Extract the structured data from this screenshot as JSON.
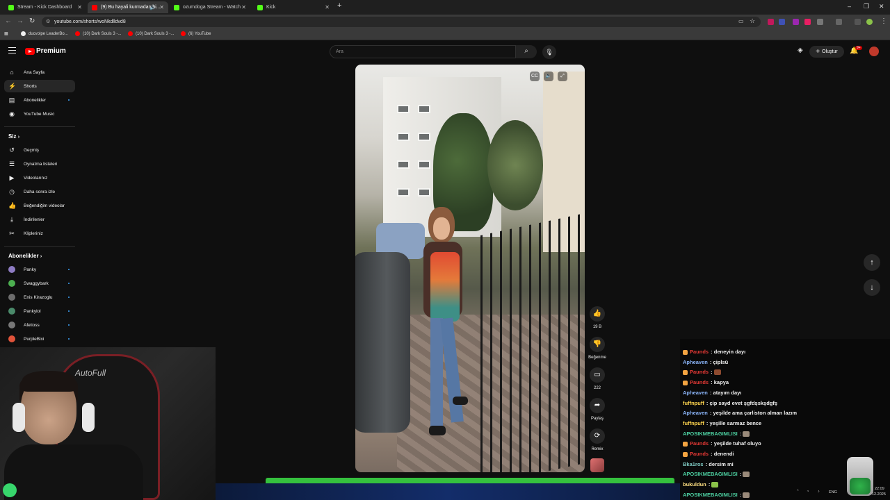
{
  "browser": {
    "tabs": [
      {
        "title": "Stream - Kick Dashboard",
        "favicon_color": "#53fc18"
      },
      {
        "title": "(9) Bu hayali kurmadan bi...",
        "favicon_color": "#ff0000"
      },
      {
        "title": "ozumdoga Stream - Watch",
        "favicon_color": "#53fc18"
      },
      {
        "title": "Kick",
        "favicon_color": "#53fc18"
      }
    ],
    "url": "youtube.com/shorts/woNkdlldvd8",
    "bookmarks": [
      "ducvolpe LeaderBo...",
      "(10) Dark Souls 3 -...",
      "(10) Dark Souls 3 -...",
      "(6) YouTube"
    ]
  },
  "youtube": {
    "brand": "Premium",
    "search_placeholder": "Ara",
    "create_label": "Oluştur",
    "notif_badge": "9+",
    "sidebar": {
      "main": [
        {
          "label": "Ana Sayfa",
          "icon": "home-icon"
        },
        {
          "label": "Shorts",
          "icon": "shorts-icon"
        },
        {
          "label": "Abonelikler",
          "icon": "subscriptions-icon"
        },
        {
          "label": "YouTube Music",
          "icon": "music-icon"
        }
      ],
      "you_title": "Siz",
      "you": [
        {
          "label": "Geçmiş",
          "icon": "history-icon"
        },
        {
          "label": "Oynatma listeleri",
          "icon": "playlist-icon"
        },
        {
          "label": "Videolarınız",
          "icon": "your-videos-icon"
        },
        {
          "label": "Daha sonra izle",
          "icon": "watch-later-icon"
        },
        {
          "label": "Beğendiğim videolar",
          "icon": "liked-icon"
        },
        {
          "label": "İndirilenler",
          "icon": "download-icon"
        },
        {
          "label": "Klipleriniz",
          "icon": "clips-icon"
        }
      ],
      "subs_title": "Abonelikler",
      "subs": [
        {
          "label": "Panky",
          "color": "#8e7cc3"
        },
        {
          "label": "Swaggybark",
          "color": "#4caf50"
        },
        {
          "label": "Enis Kirazoglu",
          "color": "#6d6d6d"
        },
        {
          "label": "Pankylol",
          "color": "#4a8a6a"
        },
        {
          "label": "Afelioss",
          "color": "#777777"
        },
        {
          "label": "PurpleBixi",
          "color": "#e0533a"
        }
      ]
    },
    "actions": {
      "like_count": "19 B",
      "dislike_label": "Beğenme",
      "comment_count": "222",
      "share_label": "Paylaş",
      "remix_label": "Remix"
    }
  },
  "webcam": {
    "chair_brand": "AutoFull"
  },
  "chat": {
    "messages": [
      {
        "user": "Paunds",
        "color": "#e53935",
        "text": "deneyin dayı",
        "badge": true
      },
      {
        "user": "Apheaven",
        "color": "#8ab4f8",
        "text": "çiplsü",
        "badge": false
      },
      {
        "user": "Paunds",
        "color": "#e53935",
        "text": "",
        "emote": true,
        "badge": true
      },
      {
        "user": "Paunds",
        "color": "#e53935",
        "text": "kapya",
        "badge": true
      },
      {
        "user": "Apheaven",
        "color": "#8ab4f8",
        "text": "atayım dayı",
        "badge": false
      },
      {
        "user": "fuffnpuff",
        "color": "#ffd54f",
        "text": "çip sayd evet şgfdşskşdgfş",
        "badge": false
      },
      {
        "user": "Apheaven",
        "color": "#8ab4f8",
        "text": "yeşilde ama çarliston alman lazım",
        "badge": false
      },
      {
        "user": "fuffnpuff",
        "color": "#ffd54f",
        "text": "yeşille sarmaz bence",
        "badge": false
      },
      {
        "user": "APOSIKMEBAGIMLISI",
        "color": "#4dd0a1",
        "text": "",
        "emote": true,
        "badge": false
      },
      {
        "user": "Paunds",
        "color": "#e53935",
        "text": "yeşilde tuhaf oluyo",
        "badge": true
      },
      {
        "user": "Paunds",
        "color": "#e53935",
        "text": "denendi",
        "badge": true
      },
      {
        "user": "Bka1ros",
        "color": "#80cbc4",
        "text": "dersim mi",
        "badge": false
      },
      {
        "user": "APOSIKMEBAGIMLISI",
        "color": "#4dd0a1",
        "text": "",
        "emote": true,
        "badge": false
      },
      {
        "user": "bukuldun",
        "color": "#ffe082",
        "text": "",
        "emote": true,
        "badge": false
      },
      {
        "user": "APOSIKMEBAGIMLISI",
        "color": "#4dd0a1",
        "text": "",
        "emote": true,
        "badge": false
      }
    ]
  },
  "taskbar": {
    "lang": "ENG",
    "time": "22:09",
    "date": "12.2025"
  }
}
